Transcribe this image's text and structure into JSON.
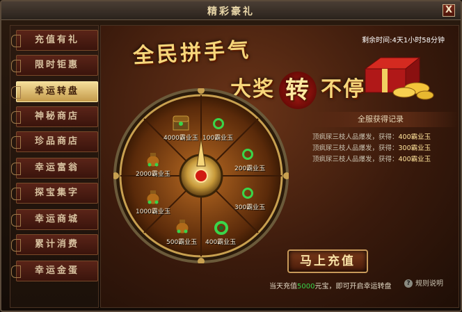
{
  "window": {
    "title": "精彩豪礼",
    "close_label": "X"
  },
  "sidebar": {
    "items": [
      {
        "label": "充值有礼",
        "active": false
      },
      {
        "label": "限时钜惠",
        "active": false
      },
      {
        "label": "幸运转盘",
        "active": true
      },
      {
        "label": "神秘商店",
        "active": false
      },
      {
        "label": "珍品商店",
        "active": false
      },
      {
        "label": "幸运富翁",
        "active": false
      },
      {
        "label": "探宝集字",
        "active": false
      },
      {
        "label": "幸运商城",
        "active": false
      },
      {
        "label": "累计消费",
        "active": false
      },
      {
        "label": "幸运金蛋",
        "active": false
      }
    ]
  },
  "banner": {
    "line1": "全民拼手气",
    "line2_before": "大奖",
    "line2_highlight": "转",
    "line2_after": "不停"
  },
  "timer": {
    "label": "剩余时间:",
    "value": "4天1小时58分钟"
  },
  "wheel": {
    "prizes": [
      {
        "label": "4000霸业玉",
        "icon": "treasure-chest-icon"
      },
      {
        "label": "100霸业玉",
        "icon": "jade-ring-icon"
      },
      {
        "label": "200霸业玉",
        "icon": "jade-ring-icon"
      },
      {
        "label": "300霸业玉",
        "icon": "jade-ring-icon"
      },
      {
        "label": "400霸业玉",
        "icon": "jade-bracelet-icon"
      },
      {
        "label": "500霸业玉",
        "icon": "treasure-bag-icon"
      },
      {
        "label": "1000霸业玉",
        "icon": "treasure-bag-icon"
      },
      {
        "label": "2000霸业玉",
        "icon": "treasure-bag-icon"
      }
    ]
  },
  "records": {
    "title": "全服获得记录",
    "rows": [
      {
        "prefix": "顶疯尿三枝人品爆发，获得：",
        "prize": "400霸业玉"
      },
      {
        "prefix": "顶疯尿三枝人品爆发，获得：",
        "prize": "300霸业玉"
      },
      {
        "prefix": "顶疯尿三枝人品爆发，获得：",
        "prize": "400霸业玉"
      }
    ]
  },
  "charge_button": {
    "label": "马上充值"
  },
  "note": {
    "before": "当天充值",
    "amount": "5000",
    "after": "元宝，即可开启幸运转盘"
  },
  "rules": {
    "label": "规则说明"
  },
  "colors": {
    "accent": "#f6d67a",
    "highlight_green": "#38d44a",
    "active_tab": "#e9c873"
  }
}
